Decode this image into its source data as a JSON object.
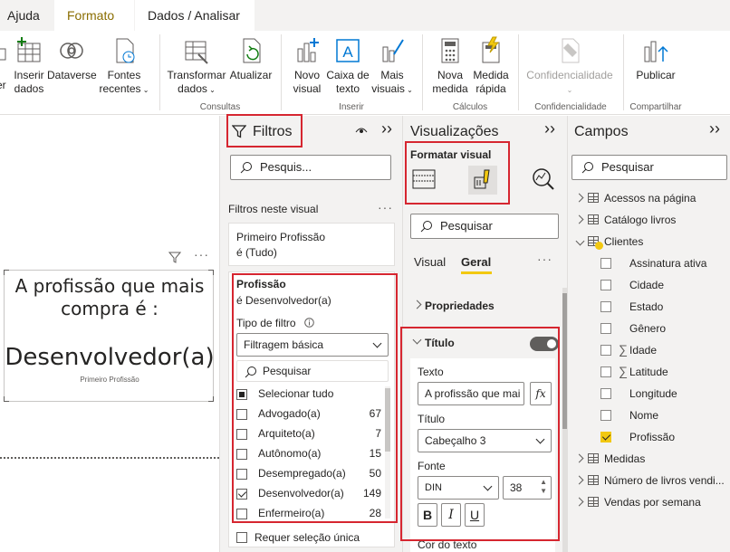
{
  "ribbon": {
    "tabs": [
      "Ajuda",
      "Formato",
      "Dados / Analisar"
    ],
    "buttons": {
      "partial_left": "er",
      "inserir_dados": [
        "Inserir",
        "dados"
      ],
      "dataverse": "Dataverse",
      "fontes_recentes": [
        "Fontes",
        "recentes"
      ],
      "transformar_dados": [
        "Transformar",
        "dados"
      ],
      "atualizar": "Atualizar",
      "novo_visual": [
        "Novo",
        "visual"
      ],
      "caixa_texto": [
        "Caixa de",
        "texto"
      ],
      "mais_visuais": [
        "Mais",
        "visuais"
      ],
      "nova_medida": [
        "Nova",
        "medida"
      ],
      "medida_rapida": [
        "Medida",
        "rápida"
      ],
      "confidencialidade": "Confidencialidade",
      "publicar": "Publicar"
    },
    "groups": {
      "consultas": "Consultas",
      "inserir": "Inserir",
      "calculos": "Cálculos",
      "confidencialidade": "Confidencialidade",
      "compartilhar": "Compartilhar"
    }
  },
  "card": {
    "title": "A profissão que mais compra é :",
    "value": "Desenvolvedor(a)",
    "label": "Primeiro Profissão"
  },
  "filters": {
    "title": "Filtros",
    "search_placeholder": "Pesquis...",
    "section_label": "Filtros neste visual",
    "filter1": {
      "line1": "Primeiro Profissão",
      "line2": "é (Tudo)"
    },
    "filter2": {
      "field": "Profissão",
      "condition": "é Desenvolvedor(a)",
      "type_label": "Tipo de filtro",
      "type_value": "Filtragem básica",
      "search_placeholder": "Pesquisar",
      "items": [
        {
          "label": "Selecionar tudo",
          "count": "",
          "state": "partial"
        },
        {
          "label": "Advogado(a)",
          "count": "67",
          "state": "off"
        },
        {
          "label": "Arquiteto(a)",
          "count": "7",
          "state": "off"
        },
        {
          "label": "Autônomo(a)",
          "count": "15",
          "state": "off"
        },
        {
          "label": "Desempregado(a)",
          "count": "50",
          "state": "off"
        },
        {
          "label": "Desenvolvedor(a)",
          "count": "149",
          "state": "on"
        },
        {
          "label": "Enfermeiro(a)",
          "count": "28",
          "state": "off"
        }
      ]
    },
    "require_single": "Requer seleção única"
  },
  "visualizations": {
    "title": "Visualizações",
    "format_label": "Formatar visual",
    "search_placeholder": "Pesquisar",
    "subtabs": [
      "Visual",
      "Geral"
    ],
    "properties": "Propriedades",
    "title_section": {
      "header": "Título",
      "text_label": "Texto",
      "text_value": "A profissão que mai",
      "fx": "fx",
      "heading_label": "Título",
      "heading_value": "Cabeçalho 3",
      "font_label": "Fonte",
      "font_value": "DIN",
      "font_size": "38",
      "bold": "B",
      "italic": "I",
      "underline": "U",
      "color_label": "Cor do texto"
    }
  },
  "fields": {
    "title": "Campos",
    "search_placeholder": "Pesquisar",
    "tables": [
      {
        "name": "Acessos na página",
        "expanded": false
      },
      {
        "name": "Catálogo livros",
        "expanded": false
      },
      {
        "name": "Clientes",
        "expanded": true
      },
      {
        "name": "Medidas",
        "expanded": false
      },
      {
        "name": "Número de livros vendi...",
        "expanded": false
      },
      {
        "name": "Vendas por semana",
        "expanded": false
      }
    ],
    "clientes_fields": [
      {
        "name": "Assinatura ativa",
        "sigma": false,
        "checked": false
      },
      {
        "name": "Cidade",
        "sigma": false,
        "checked": false
      },
      {
        "name": "Estado",
        "sigma": false,
        "checked": false
      },
      {
        "name": "Gênero",
        "sigma": false,
        "checked": false
      },
      {
        "name": "Idade",
        "sigma": true,
        "checked": false
      },
      {
        "name": "Latitude",
        "sigma": true,
        "checked": false
      },
      {
        "name": "Longitude",
        "sigma": false,
        "checked": false
      },
      {
        "name": "Nome",
        "sigma": false,
        "checked": false
      },
      {
        "name": "Profissão",
        "sigma": false,
        "checked": true
      }
    ]
  },
  "colors": {
    "highlight": "#d62630",
    "accent_yellow": "#f2c811",
    "pane_bg": "#f3f2f1"
  }
}
